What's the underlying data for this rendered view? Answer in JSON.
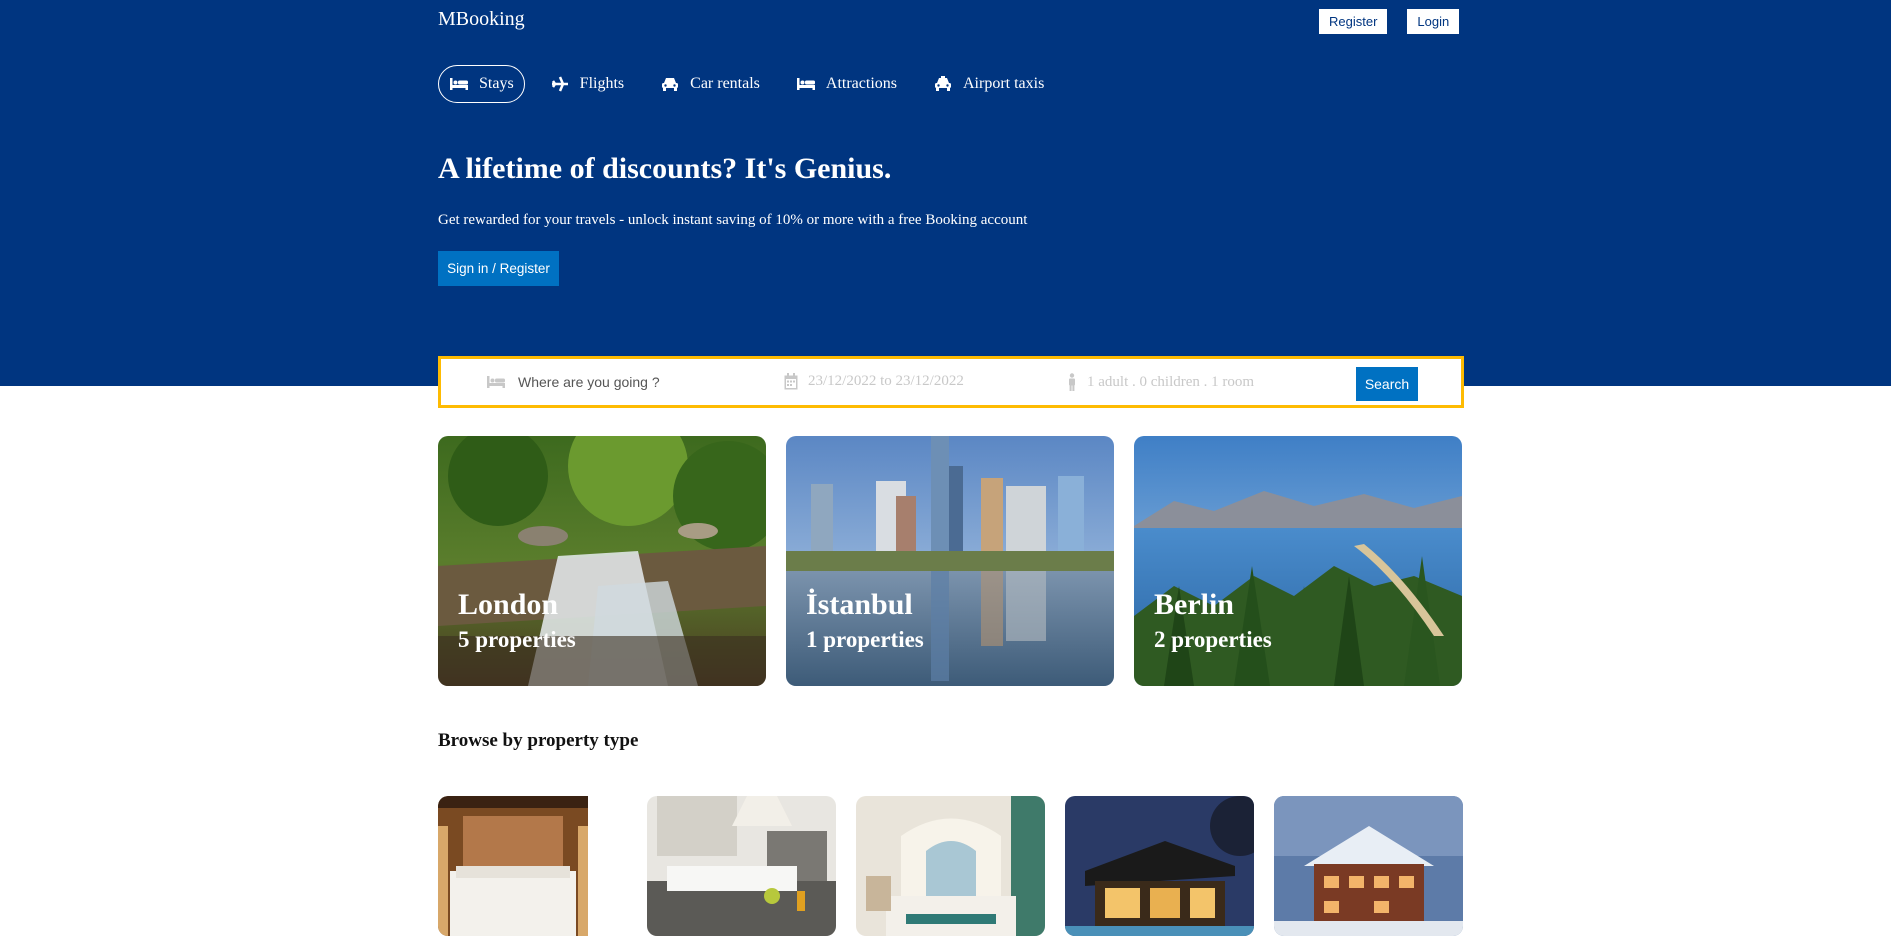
{
  "header": {
    "logo": "MBooking",
    "register_label": "Register",
    "login_label": "Login",
    "nav": [
      {
        "label": "Stays",
        "icon": "bed-icon",
        "active": true
      },
      {
        "label": "Flights",
        "icon": "plane-icon",
        "active": false
      },
      {
        "label": "Car rentals",
        "icon": "car-icon",
        "active": false
      },
      {
        "label": "Attractions",
        "icon": "bed-icon",
        "active": false
      },
      {
        "label": "Airport taxis",
        "icon": "taxi-icon",
        "active": false
      }
    ],
    "headline": "A lifetime of discounts? It's Genius.",
    "subline": "Get rewarded for your travels - unlock instant saving of 10% or more with a free Booking account",
    "signin_label": "Sign in / Register"
  },
  "search": {
    "destination_placeholder": "Where are you going ?",
    "dates": "23/12/2022 to 23/12/2022",
    "guests": "1 adult . 0 children . 1 room",
    "search_label": "Search"
  },
  "featured": [
    {
      "city": "London",
      "count": "5 properties"
    },
    {
      "city": "İstanbul",
      "count": "1 properties"
    },
    {
      "city": "Berlin",
      "count": "2 properties"
    }
  ],
  "browse": {
    "title": "Browse by property type"
  },
  "colors": {
    "header_bg": "#003580",
    "button_blue": "#0071c2",
    "search_border": "#febb02"
  }
}
